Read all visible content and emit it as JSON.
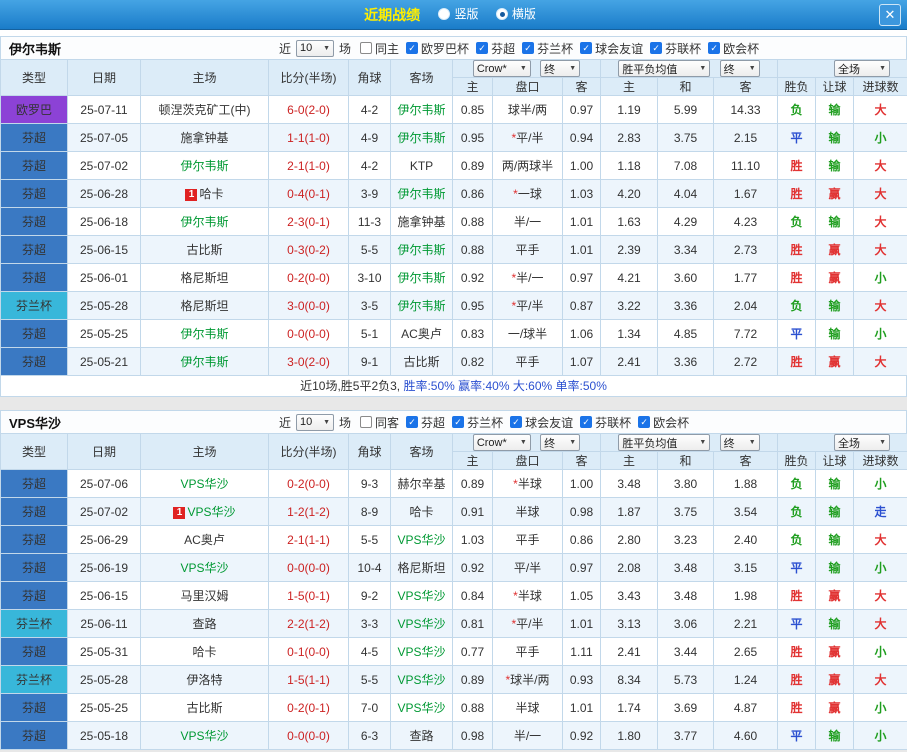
{
  "titlebar": {
    "title": "近期战绩",
    "options": [
      {
        "label": "竖版",
        "selected": false
      },
      {
        "label": "横版",
        "selected": true
      }
    ],
    "close_glyph": "✕"
  },
  "table_header": {
    "cols": [
      "类型",
      "日期",
      "主场",
      "比分(半场)",
      "角球",
      "客场"
    ],
    "dropdowns": {
      "company": "Crow*",
      "final1": "终",
      "odds_avg": "胜平负均值",
      "final2": "终",
      "scope": "全场"
    },
    "subcols": [
      "主",
      "盘口",
      "客",
      "主",
      "和",
      "客",
      "胜负",
      "让球",
      "进球数"
    ]
  },
  "colors": {
    "titlebar_bg": "#1f86d0",
    "title_text": "#ffee00",
    "type": {
      "欧罗巴": "#8c42d6",
      "芬超": "#3a79c3",
      "芬兰杯": "#38b7da"
    },
    "team_highlight": "#009933",
    "score": "#cc2222",
    "star": "#e03030",
    "result": {
      "胜": "#e13232",
      "平": "#2b50d0",
      "负": "#1f9e1f"
    },
    "handicap_result": {
      "赢": "#e13232",
      "输": "#1f9e1f",
      "走": "#2b50d0"
    },
    "goals": {
      "大": "#e13232",
      "小": "#1f9e1f",
      "走": "#2b50d0"
    }
  },
  "sections": [
    {
      "team": "伊尔韦斯",
      "filter": {
        "near_label": "近",
        "count": "10",
        "games_label": "场",
        "same_option": {
          "label": "同主",
          "checked": false
        },
        "leagues": [
          {
            "label": "欧罗巴杯",
            "checked": true
          },
          {
            "label": "芬超",
            "checked": true
          },
          {
            "label": "芬兰杯",
            "checked": true
          },
          {
            "label": "球会友谊",
            "checked": true
          },
          {
            "label": "芬联杯",
            "checked": true
          },
          {
            "label": "欧会杯",
            "checked": true
          }
        ]
      },
      "rows": [
        {
          "type": "欧罗巴",
          "date": "25-07-11",
          "home": "顿涅茨克矿工(中)",
          "home_hl": false,
          "home_badge": "",
          "score": "6-0(2-0)",
          "corner": "4-2",
          "away": "伊尔韦斯",
          "away_hl": true,
          "h": "0.85",
          "hcap": "球半/两",
          "a": "0.97",
          "w": "1.19",
          "d": "5.99",
          "l": "14.33",
          "res": "负",
          "let": "输",
          "goals": "大"
        },
        {
          "type": "芬超",
          "date": "25-07-05",
          "home": "施拿钟基",
          "home_hl": false,
          "home_badge": "",
          "score": "1-1(1-0)",
          "corner": "4-9",
          "away": "伊尔韦斯",
          "away_hl": true,
          "h": "0.95",
          "hcap": "*平/半",
          "a": "0.94",
          "w": "2.83",
          "d": "3.75",
          "l": "2.15",
          "res": "平",
          "let": "输",
          "goals": "小"
        },
        {
          "type": "芬超",
          "date": "25-07-02",
          "home": "伊尔韦斯",
          "home_hl": true,
          "home_badge": "",
          "score": "2-1(1-0)",
          "corner": "4-2",
          "away": "KTP",
          "away_hl": false,
          "h": "0.89",
          "hcap": "两/两球半",
          "a": "1.00",
          "w": "1.18",
          "d": "7.08",
          "l": "11.10",
          "res": "胜",
          "let": "输",
          "goals": "大"
        },
        {
          "type": "芬超",
          "date": "25-06-28",
          "home": "哈卡",
          "home_hl": false,
          "home_badge": "1",
          "score": "0-4(0-1)",
          "corner": "3-9",
          "away": "伊尔韦斯",
          "away_hl": true,
          "h": "0.86",
          "hcap": "*一球",
          "a": "1.03",
          "w": "4.20",
          "d": "4.04",
          "l": "1.67",
          "res": "胜",
          "let": "赢",
          "goals": "大"
        },
        {
          "type": "芬超",
          "date": "25-06-18",
          "home": "伊尔韦斯",
          "home_hl": true,
          "home_badge": "",
          "score": "2-3(0-1)",
          "corner": "11-3",
          "away": "施拿钟基",
          "away_hl": false,
          "h": "0.88",
          "hcap": "半/一",
          "a": "1.01",
          "w": "1.63",
          "d": "4.29",
          "l": "4.23",
          "res": "负",
          "let": "输",
          "goals": "大"
        },
        {
          "type": "芬超",
          "date": "25-06-15",
          "home": "古比斯",
          "home_hl": false,
          "home_badge": "",
          "score": "0-3(0-2)",
          "corner": "5-5",
          "away": "伊尔韦斯",
          "away_hl": true,
          "h": "0.88",
          "hcap": "平手",
          "a": "1.01",
          "w": "2.39",
          "d": "3.34",
          "l": "2.73",
          "res": "胜",
          "let": "赢",
          "goals": "大"
        },
        {
          "type": "芬超",
          "date": "25-06-01",
          "home": "格尼斯坦",
          "home_hl": false,
          "home_badge": "",
          "score": "0-2(0-0)",
          "corner": "3-10",
          "away": "伊尔韦斯",
          "away_hl": true,
          "h": "0.92",
          "hcap": "*半/一",
          "a": "0.97",
          "w": "4.21",
          "d": "3.60",
          "l": "1.77",
          "res": "胜",
          "let": "赢",
          "goals": "小"
        },
        {
          "type": "芬兰杯",
          "date": "25-05-28",
          "home": "格尼斯坦",
          "home_hl": false,
          "home_badge": "",
          "score": "3-0(0-0)",
          "corner": "3-5",
          "away": "伊尔韦斯",
          "away_hl": true,
          "h": "0.95",
          "hcap": "*平/半",
          "a": "0.87",
          "w": "3.22",
          "d": "3.36",
          "l": "2.04",
          "res": "负",
          "let": "输",
          "goals": "大"
        },
        {
          "type": "芬超",
          "date": "25-05-25",
          "home": "伊尔韦斯",
          "home_hl": true,
          "home_badge": "",
          "score": "0-0(0-0)",
          "corner": "5-1",
          "away": "AC奥卢",
          "away_hl": false,
          "h": "0.83",
          "hcap": "一/球半",
          "a": "1.06",
          "w": "1.34",
          "d": "4.85",
          "l": "7.72",
          "res": "平",
          "let": "输",
          "goals": "小"
        },
        {
          "type": "芬超",
          "date": "25-05-21",
          "home": "伊尔韦斯",
          "home_hl": true,
          "home_badge": "",
          "score": "3-0(2-0)",
          "corner": "9-1",
          "away": "古比斯",
          "away_hl": false,
          "h": "0.82",
          "hcap": "平手",
          "a": "1.07",
          "w": "2.41",
          "d": "3.36",
          "l": "2.72",
          "res": "胜",
          "let": "赢",
          "goals": "大"
        }
      ],
      "summary_segments": [
        {
          "text": "近10场,胜5平2负3, ",
          "color": "#333333"
        },
        {
          "text": "胜率:50%",
          "color": "#2b50d0"
        },
        {
          "text": " 赢率:40%",
          "color": "#2b50d0"
        },
        {
          "text": " 大:60%",
          "color": "#2b50d0"
        },
        {
          "text": " 单率:50%",
          "color": "#2b50d0"
        }
      ]
    },
    {
      "team": "VPS华沙",
      "filter": {
        "near_label": "近",
        "count": "10",
        "games_label": "场",
        "same_option": {
          "label": "同客",
          "checked": false
        },
        "leagues": [
          {
            "label": "芬超",
            "checked": true
          },
          {
            "label": "芬兰杯",
            "checked": true
          },
          {
            "label": "球会友谊",
            "checked": true
          },
          {
            "label": "芬联杯",
            "checked": true
          },
          {
            "label": "欧会杯",
            "checked": true
          }
        ]
      },
      "rows": [
        {
          "type": "芬超",
          "date": "25-07-06",
          "home": "VPS华沙",
          "home_hl": true,
          "home_badge": "",
          "score": "0-2(0-0)",
          "corner": "9-3",
          "away": "赫尔辛基",
          "away_hl": false,
          "h": "0.89",
          "hcap": "*半球",
          "a": "1.00",
          "w": "3.48",
          "d": "3.80",
          "l": "1.88",
          "res": "负",
          "let": "输",
          "goals": "小"
        },
        {
          "type": "芬超",
          "date": "25-07-02",
          "home": "VPS华沙",
          "home_hl": true,
          "home_badge": "1",
          "score": "1-2(1-2)",
          "corner": "8-9",
          "away": "哈卡",
          "away_hl": false,
          "h": "0.91",
          "hcap": "半球",
          "a": "0.98",
          "w": "1.87",
          "d": "3.75",
          "l": "3.54",
          "res": "负",
          "let": "输",
          "goals": "走"
        },
        {
          "type": "芬超",
          "date": "25-06-29",
          "home": "AC奥卢",
          "home_hl": false,
          "home_badge": "",
          "score": "2-1(1-1)",
          "corner": "5-5",
          "away": "VPS华沙",
          "away_hl": true,
          "h": "1.03",
          "hcap": "平手",
          "a": "0.86",
          "w": "2.80",
          "d": "3.23",
          "l": "2.40",
          "res": "负",
          "let": "输",
          "goals": "大"
        },
        {
          "type": "芬超",
          "date": "25-06-19",
          "home": "VPS华沙",
          "home_hl": true,
          "home_badge": "",
          "score": "0-0(0-0)",
          "corner": "10-4",
          "away": "格尼斯坦",
          "away_hl": false,
          "h": "0.92",
          "hcap": "平/半",
          "a": "0.97",
          "w": "2.08",
          "d": "3.48",
          "l": "3.15",
          "res": "平",
          "let": "输",
          "goals": "小"
        },
        {
          "type": "芬超",
          "date": "25-06-15",
          "home": "马里汉姆",
          "home_hl": false,
          "home_badge": "",
          "score": "1-5(0-1)",
          "corner": "9-2",
          "away": "VPS华沙",
          "away_hl": true,
          "h": "0.84",
          "hcap": "*半球",
          "a": "1.05",
          "w": "3.43",
          "d": "3.48",
          "l": "1.98",
          "res": "胜",
          "let": "赢",
          "goals": "大"
        },
        {
          "type": "芬兰杯",
          "date": "25-06-11",
          "home": "查路",
          "home_hl": false,
          "home_badge": "",
          "score": "2-2(1-2)",
          "corner": "3-3",
          "away": "VPS华沙",
          "away_hl": true,
          "h": "0.81",
          "hcap": "*平/半",
          "a": "1.01",
          "w": "3.13",
          "d": "3.06",
          "l": "2.21",
          "res": "平",
          "let": "输",
          "goals": "大"
        },
        {
          "type": "芬超",
          "date": "25-05-31",
          "home": "哈卡",
          "home_hl": false,
          "home_badge": "",
          "score": "0-1(0-0)",
          "corner": "4-5",
          "away": "VPS华沙",
          "away_hl": true,
          "h": "0.77",
          "hcap": "平手",
          "a": "1.11",
          "w": "2.41",
          "d": "3.44",
          "l": "2.65",
          "res": "胜",
          "let": "赢",
          "goals": "小"
        },
        {
          "type": "芬兰杯",
          "date": "25-05-28",
          "home": "伊洛特",
          "home_hl": false,
          "home_badge": "",
          "score": "1-5(1-1)",
          "corner": "5-5",
          "away": "VPS华沙",
          "away_hl": true,
          "h": "0.89",
          "hcap": "*球半/两",
          "a": "0.93",
          "w": "8.34",
          "d": "5.73",
          "l": "1.24",
          "res": "胜",
          "let": "赢",
          "goals": "大"
        },
        {
          "type": "芬超",
          "date": "25-05-25",
          "home": "古比斯",
          "home_hl": false,
          "home_badge": "",
          "score": "0-2(0-1)",
          "corner": "7-0",
          "away": "VPS华沙",
          "away_hl": true,
          "h": "0.88",
          "hcap": "半球",
          "a": "1.01",
          "w": "1.74",
          "d": "3.69",
          "l": "4.87",
          "res": "胜",
          "let": "赢",
          "goals": "小"
        },
        {
          "type": "芬超",
          "date": "25-05-18",
          "home": "VPS华沙",
          "home_hl": true,
          "home_badge": "",
          "score": "0-0(0-0)",
          "corner": "6-3",
          "away": "查路",
          "away_hl": false,
          "h": "0.98",
          "hcap": "半/一",
          "a": "0.92",
          "w": "1.80",
          "d": "3.77",
          "l": "4.60",
          "res": "平",
          "let": "输",
          "goals": "小"
        }
      ],
      "summary_segments": []
    }
  ]
}
